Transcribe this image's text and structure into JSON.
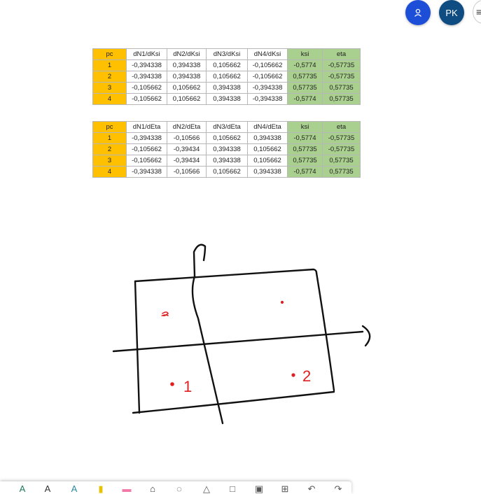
{
  "header": {
    "avatar_user_icon": "person-icon",
    "avatar_initials": "PK",
    "menu_icon": "more-icon"
  },
  "table1": {
    "headers": [
      "pc",
      "dN1/dKsi",
      "dN2/dKsi",
      "dN3/dKsi",
      "dN4/dKsi",
      "ksi",
      "eta"
    ],
    "rows": [
      [
        "1",
        "-0,394338",
        "0,394338",
        "0,105662",
        "-0,105662",
        "-0,5774",
        "-0,57735"
      ],
      [
        "2",
        "-0,394338",
        "0,394338",
        "0,105662",
        "-0,105662",
        "0,57735",
        "-0,57735"
      ],
      [
        "3",
        "-0,105662",
        "0,105662",
        "0,394338",
        "-0,394338",
        "0,57735",
        "0,57735"
      ],
      [
        "4",
        "-0,105662",
        "0,105662",
        "0,394338",
        "-0,394338",
        "-0,5774",
        "0,57735"
      ]
    ]
  },
  "table2": {
    "headers": [
      "pc",
      "dN1/dEta",
      "dN2/dEta",
      "dN3/dEta",
      "dN4/dEta",
      "ksi",
      "eta"
    ],
    "rows": [
      [
        "1",
        "-0,394338",
        "-0,10566",
        "0,105662",
        "0,394338",
        "-0,5774",
        "-0,57735"
      ],
      [
        "2",
        "-0,105662",
        "-0,39434",
        "0,394338",
        "0,105662",
        "0,57735",
        "-0,57735"
      ],
      [
        "3",
        "-0,105662",
        "-0,39434",
        "0,394338",
        "0,105662",
        "0,57735",
        "0,57735"
      ],
      [
        "4",
        "-0,394338",
        "-0,10566",
        "0,105662",
        "0,394338",
        "-0,5774",
        "0,57735"
      ]
    ]
  },
  "sketch": {
    "labels": [
      "1",
      "2"
    ],
    "ink_color": "#111111",
    "point_color": "#e02020"
  },
  "toolbar": {
    "tools": [
      {
        "name": "pen-green-icon",
        "glyph": "A",
        "color": "#1f7a55"
      },
      {
        "name": "pen-black-icon",
        "glyph": "A",
        "color": "#333333"
      },
      {
        "name": "pen-teal-icon",
        "glyph": "A",
        "color": "#2a8aa0"
      },
      {
        "name": "highlighter-yellow-icon",
        "glyph": "▮",
        "color": "#e8c200"
      },
      {
        "name": "highlighter-pink-icon",
        "glyph": "▬",
        "color": "#f27aa8"
      },
      {
        "name": "eraser-icon",
        "glyph": "⌂",
        "color": "#333333"
      },
      {
        "name": "lasso-icon",
        "glyph": "◌",
        "color": "#333333"
      },
      {
        "name": "ruler-icon",
        "glyph": "△",
        "color": "#555555"
      },
      {
        "name": "shape-icon",
        "glyph": "□",
        "color": "#555555"
      },
      {
        "name": "image-icon",
        "glyph": "▣",
        "color": "#555555"
      },
      {
        "name": "add-page-icon",
        "glyph": "⊞",
        "color": "#555555"
      },
      {
        "name": "undo-icon",
        "glyph": "↶",
        "color": "#555555"
      },
      {
        "name": "redo-icon",
        "glyph": "↷",
        "color": "#555555"
      }
    ]
  }
}
